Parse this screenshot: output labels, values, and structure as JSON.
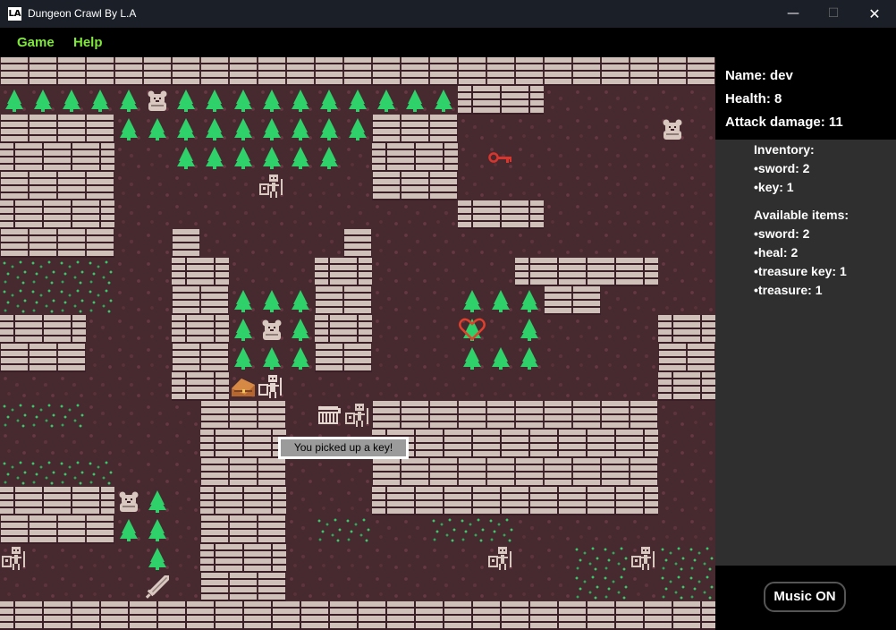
{
  "window": {
    "app_icon_glyph": "LA",
    "title": "Dungeon Crawl By L.A",
    "minimize_glyph": "—",
    "maximize_glyph": "☐",
    "close_glyph": "✕"
  },
  "menu": {
    "game": "Game",
    "help": "Help"
  },
  "player": {
    "name_line": "Name:  dev",
    "health_line": "Health: 8",
    "attack_line": "Attack damage: 11"
  },
  "inventory": {
    "title": "Inventory:",
    "items": [
      "•sword: 2",
      "•key: 1"
    ]
  },
  "available": {
    "title": "Available items:",
    "items": [
      "•sword: 2",
      "•heal: 2",
      "•treasure key: 1",
      "•treasure: 1"
    ]
  },
  "message": "You picked up a key!",
  "music_button": "Music ON",
  "colors": {
    "menu_text": "#7fe83a",
    "floor": "#472a30",
    "wall": "#cfc0ba",
    "tree": "#2ed16a",
    "key": "#d9352c",
    "heart": "#e0402c"
  },
  "map": {
    "cols": 25,
    "rows": 20,
    "grid": [
      "WWWWWWWWWWWWWWWWWWWWWWWWW",
      "TTTTTBTTTTTTTTTTWWWFFFFFF",
      "WWWWTTTTTTTTTWWWFFFFFFFFF",
      "WWWWFFTTTTTTFWWWFKFFFFFFF",
      "WWWWFFFFFFFFFWWWFFFFFFFFF",
      "WWWWFFFFFFFFFFFFWWWFFFFFF",
      "WWWWFFWFFFFFWFFFFFFFFFFFF",
      "GGGGFFWWFFFWWFFFFFWWWWWFF",
      "GGGGFFWWTTTWWFFFTTTWWFFFF",
      "WWWFFFWWTBTWWFFFTHTFFFFWW",
      "WWWFFFWWTTTWWFFFTTTFFFFWW",
      "FFFFFFWWFFFFFFFFFFFFFFFWW",
      "GGGFFFFWWWFFFWWWWWWWWWWFF",
      "FFFFFFFWWWFFFWWWWWWWWWWFF",
      "GGGGFFFWWWFFFWWWWWWWWWWFF",
      "WWWWBTFWWWFFFWWWWWWWWWWFF",
      "WWWWTTFWWWFGGFFGGGFFFFFFF",
      "FFFFFTFWWWFFFFFFFFFFGGFGG",
      "FFFFFFFWWWFFFFFFFFFFGGFGG",
      "WWWWWWWWWWWWWWWWWWWWWWWWW"
    ],
    "entities": [
      {
        "kind": "bear",
        "name": "bear-monster",
        "col": 5,
        "row": 1
      },
      {
        "kind": "bear",
        "name": "bear-monster",
        "col": 23,
        "row": 2
      },
      {
        "kind": "key",
        "name": "key-item",
        "col": 17,
        "row": 3
      },
      {
        "kind": "skeleton",
        "name": "skeleton-monster",
        "col": 9,
        "row": 4
      },
      {
        "kind": "bear",
        "name": "bear-monster",
        "col": 9,
        "row": 9
      },
      {
        "kind": "heart",
        "name": "heal-heart-item",
        "col": 16,
        "row": 9
      },
      {
        "kind": "treasure",
        "name": "treasure-chest-item",
        "col": 8,
        "row": 11
      },
      {
        "kind": "player",
        "name": "player-character",
        "col": 9,
        "row": 11
      },
      {
        "kind": "door",
        "name": "door-tile",
        "col": 11,
        "row": 12
      },
      {
        "kind": "skeleton",
        "name": "skeleton-monster",
        "col": 12,
        "row": 12
      },
      {
        "kind": "bear",
        "name": "bear-monster",
        "col": 4,
        "row": 15
      },
      {
        "kind": "skeleton",
        "name": "skeleton-monster",
        "col": 0,
        "row": 17
      },
      {
        "kind": "skeleton",
        "name": "skeleton-monster",
        "col": 17,
        "row": 17
      },
      {
        "kind": "skeleton",
        "name": "skeleton-monster",
        "col": 22,
        "row": 17
      },
      {
        "kind": "sword",
        "name": "sword-item",
        "col": 5,
        "row": 18
      }
    ]
  }
}
